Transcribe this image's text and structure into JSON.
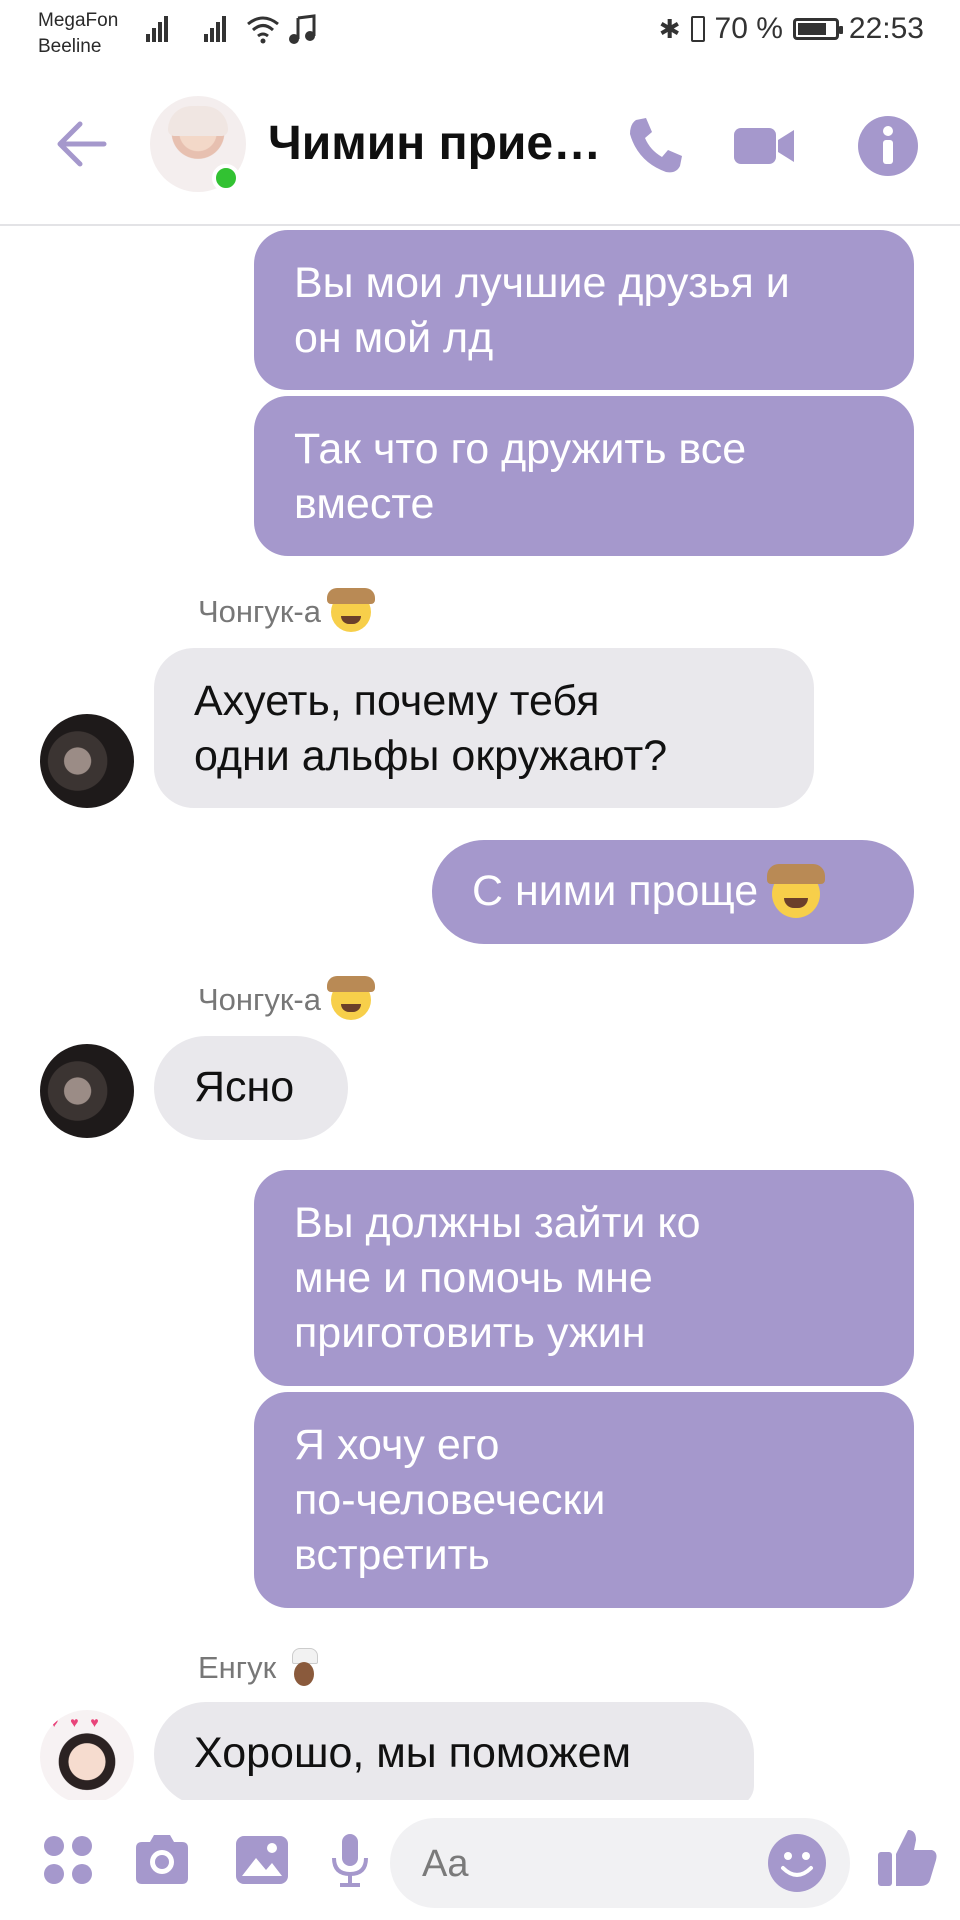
{
  "status_bar": {
    "carrier1": "MegaFon",
    "carrier2": "Beeline",
    "battery": "70 %",
    "time": "22:53"
  },
  "header": {
    "title": "Чимин прие…",
    "accent_color": "#a598cc",
    "icons": [
      "back-arrow-icon",
      "phone-icon",
      "video-camera-icon",
      "info-icon"
    ]
  },
  "messages": [
    {
      "type": "out",
      "text_lines": [
        "Вы мои лучшие друзья и",
        "он мой лд"
      ]
    },
    {
      "type": "out",
      "text_lines": [
        "Так что го дружить все",
        "вместе"
      ]
    },
    {
      "type": "in",
      "sender": "Чонгук-а",
      "text_lines": [
        "Ахуеть, почему тебя",
        "одни альфы окружают?"
      ]
    },
    {
      "type": "out",
      "text": "С ними проще"
    },
    {
      "type": "in",
      "sender": "Чонгук-а",
      "text": "Ясно"
    },
    {
      "type": "out",
      "text_lines": [
        "Вы должны зайти ко",
        "мне и помочь мне",
        "приготовить ужин"
      ]
    },
    {
      "type": "out",
      "text_lines": [
        "Я хочу его",
        "по-человечески",
        "встретить"
      ]
    },
    {
      "type": "in",
      "sender": "Енгук",
      "text": "Хорошо, мы поможем"
    }
  ],
  "composer": {
    "placeholder": "Aa",
    "icons": [
      "apps-icon",
      "camera-icon",
      "gallery-icon",
      "microphone-icon",
      "emoji-icon",
      "thumbs-up-icon"
    ]
  },
  "colors": {
    "outgoing_bubble": "#a598cc",
    "incoming_bubble": "#e9e8ec",
    "online": "#32c232"
  }
}
